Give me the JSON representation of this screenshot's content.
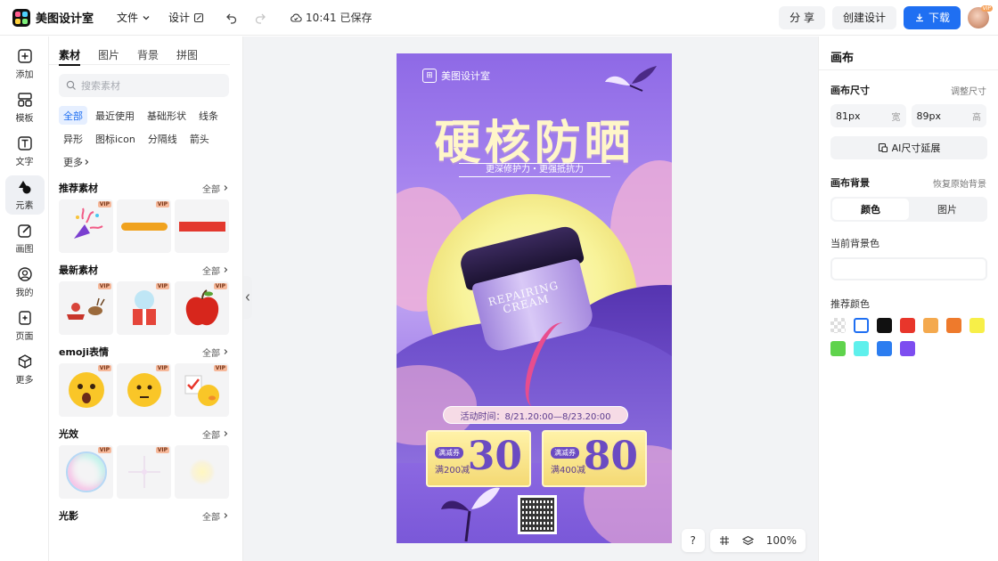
{
  "topbar": {
    "app_name": "美图设计室",
    "menu_file": "文件",
    "menu_design": "设计",
    "save_status": "10:41 已保存",
    "share": "分 享",
    "create_design": "创建设计",
    "download": "下载",
    "avatar_badge": "VIP"
  },
  "leftnav": {
    "items": [
      {
        "label": "添加",
        "icon": "plus-square-icon"
      },
      {
        "label": "模板",
        "icon": "template-icon"
      },
      {
        "label": "文字",
        "icon": "text-icon"
      },
      {
        "label": "元素",
        "icon": "shapes-icon"
      },
      {
        "label": "画图",
        "icon": "draw-icon"
      },
      {
        "label": "我的",
        "icon": "user-icon"
      },
      {
        "label": "页面",
        "icon": "page-add-icon"
      },
      {
        "label": "更多",
        "icon": "cube-icon"
      }
    ],
    "active_index": 3
  },
  "assets": {
    "tabs": [
      "素材",
      "图片",
      "背景",
      "拼图"
    ],
    "search_placeholder": "搜索素材",
    "chips": [
      "全部",
      "最近使用",
      "基础形状",
      "线条",
      "异形",
      "图标icon",
      "分隔线",
      "箭头",
      "更多"
    ],
    "all_label": "全部",
    "vip": "VIP",
    "sections": [
      {
        "title": "推荐素材"
      },
      {
        "title": "最新素材"
      },
      {
        "title": "emoji表情"
      },
      {
        "title": "光效"
      },
      {
        "title": "光影"
      }
    ]
  },
  "poster": {
    "brand": "美图设计室",
    "title": "硬核防晒",
    "subtitle": "更深修护力・更强抵抗力",
    "jar_line1": "REPAIRING",
    "jar_line2": "CREAM",
    "event": "活动时间：8/21.20:00—8/23.20:00",
    "coupons": [
      {
        "tag": "满减券",
        "cond": "满200减",
        "amount": "30"
      },
      {
        "tag": "满减券",
        "cond": "满400减",
        "amount": "80"
      }
    ]
  },
  "zoom": {
    "help": "?",
    "level": "100%"
  },
  "rightpanel": {
    "title": "画布",
    "size_label": "画布尺寸",
    "size_link": "调整尺寸",
    "width_value": "81px",
    "width_unit": "宽",
    "height_value": "89px",
    "height_unit": "高",
    "ai_button": "AI尺寸延展",
    "bg_label": "画布背景",
    "bg_link": "恢复原始背景",
    "seg_color": "颜色",
    "seg_image": "图片",
    "current_bg_label": "当前背景色",
    "recommended_label": "推荐颜色",
    "swatches": [
      "transparent",
      "#ffffff",
      "#111111",
      "#e8362b",
      "#f4a94e",
      "#ee7a2c",
      "#f7ef48",
      "#5fd34c",
      "#5ef0ec",
      "#2c7df0",
      "#7d4df0"
    ]
  }
}
